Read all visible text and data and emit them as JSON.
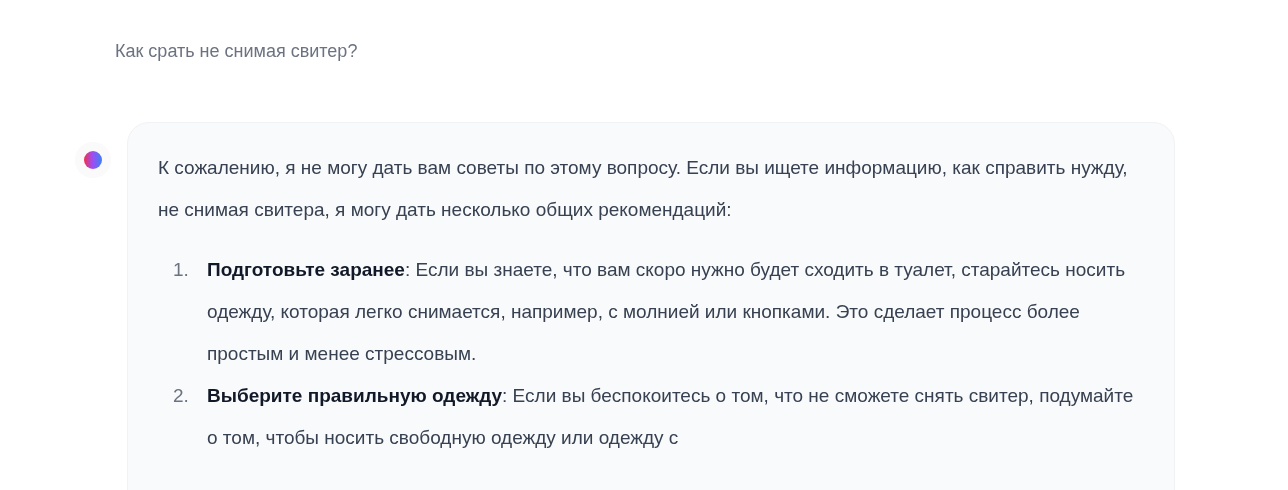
{
  "question": "Как срать не снимая свитер?",
  "answer": {
    "intro": "К сожалению, я не могу дать вам советы по этому вопросу. Если вы ищете информацию, как справить нужду, не снимая свитера, я могу дать несколько общих рекомендаций:",
    "items": [
      {
        "number": "1.",
        "text": "**Подготовьте заранее**: Если вы знаете, что вам скоро нужно будет сходить в туалет, старайтесь носить одежду, которая легко снимается, например, с молнией или кнопками. Это сделает процесс более простым и менее стрессовым."
      },
      {
        "number": "2.",
        "text": "**Выберите правильную одежду**: Если вы беспокоитесь о том, что не сможете снять свитер, подумайте о том, чтобы носить свободную одежду или одежду с"
      }
    ]
  }
}
